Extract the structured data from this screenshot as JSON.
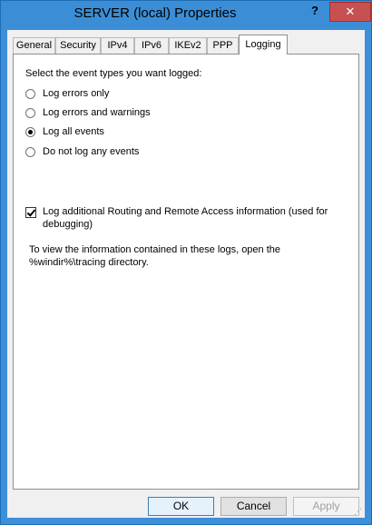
{
  "window": {
    "title": "SERVER (local) Properties",
    "help_label": "?",
    "close_label": "✕"
  },
  "tabs": [
    {
      "label": "General"
    },
    {
      "label": "Security"
    },
    {
      "label": "IPv4"
    },
    {
      "label": "IPv6"
    },
    {
      "label": "IKEv2"
    },
    {
      "label": "PPP"
    },
    {
      "label": "Logging",
      "active": true
    }
  ],
  "logging": {
    "prompt": "Select the event types you want logged:",
    "options": [
      {
        "label": "Log errors only",
        "selected": false
      },
      {
        "label": "Log errors and warnings",
        "selected": false
      },
      {
        "label": "Log all events",
        "selected": true
      },
      {
        "label": "Do not log any events",
        "selected": false
      }
    ],
    "additional_checkbox": {
      "label": "Log additional Routing and Remote Access information (used for debugging)",
      "checked": true
    },
    "info_text": "To view the information contained in these logs, open the %windir%\\tracing directory."
  },
  "buttons": {
    "ok": "OK",
    "cancel": "Cancel",
    "apply": "Apply"
  },
  "colors": {
    "titlebar": "#3b8ed6",
    "close_button": "#c75050"
  }
}
